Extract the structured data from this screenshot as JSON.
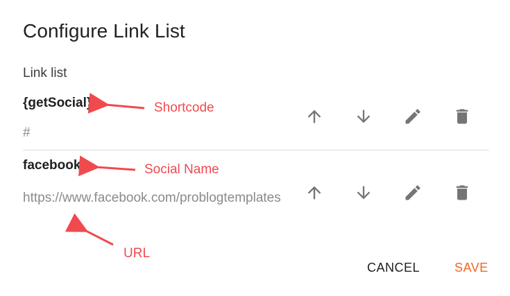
{
  "dialog": {
    "title": "Configure Link List",
    "section_label": "Link list"
  },
  "items": [
    {
      "name": "{getSocial}",
      "url": "#"
    },
    {
      "name": "facebook",
      "url": "https://www.facebook.com/problogtemplates"
    }
  ],
  "annotations": {
    "shortcode": "Shortcode",
    "social_name": "Social Name",
    "url": "URL"
  },
  "buttons": {
    "cancel": "CANCEL",
    "save": "SAVE"
  },
  "icons": {
    "move_up": "arrow-up-icon",
    "move_down": "arrow-down-icon",
    "edit": "pencil-icon",
    "delete": "trash-icon"
  },
  "colors": {
    "annotation": "#f04a4f",
    "accent": "#f26522",
    "icon": "#757575"
  }
}
